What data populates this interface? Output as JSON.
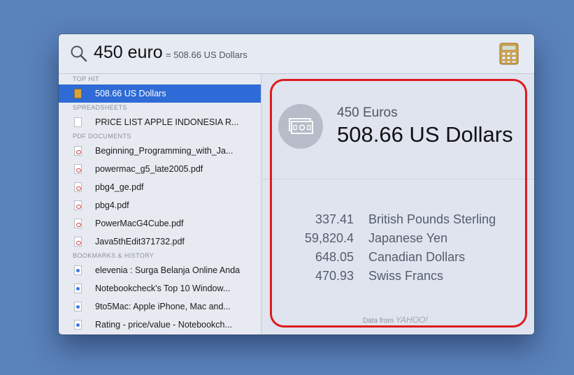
{
  "search": {
    "query": "450 euro",
    "inline_result": "= 508.66 US Dollars"
  },
  "icons": {
    "search": "magnifier-icon",
    "calculator": "calculator-icon",
    "currency": "banknote-icon"
  },
  "sections": {
    "top_hit": "TOP HIT",
    "spreadsheets": "SPREADSHEETS",
    "pdf_documents": "PDF DOCUMENTS",
    "bookmarks": "BOOKMARKS & HISTORY"
  },
  "items": {
    "top_hit": "508.66 US Dollars",
    "spreadsheets": [
      "PRICE LIST APPLE INDONESIA R..."
    ],
    "pdfs": [
      "Beginning_Programming_with_Ja...",
      "powermac_g5_late2005.pdf",
      "pbg4_ge.pdf",
      "pbg4.pdf",
      "PowerMacG4Cube.pdf",
      "Java5thEdit371732.pdf"
    ],
    "bookmarks": [
      "elevenia : Surga Belanja Online Anda",
      "Notebookcheck's Top 10 Window...",
      "9to5Mac: Apple iPhone, Mac and...",
      "Rating - price/value - Notebookch..."
    ]
  },
  "detail": {
    "source_amount": "450 Euros",
    "converted": "508.66 US Dollars",
    "rates": [
      {
        "value": "337.41",
        "currency": "British Pounds Sterling"
      },
      {
        "value": "59,820.4",
        "currency": "Japanese Yen"
      },
      {
        "value": "648.05",
        "currency": "Canadian Dollars"
      },
      {
        "value": "470.93",
        "currency": "Swiss Francs"
      }
    ],
    "credit_prefix": "Data from",
    "credit_brand": "YAHOO!"
  },
  "colors": {
    "desktop": "#5a82bb",
    "selection": "#2e6bd6",
    "annotation": "#dd1b1b"
  }
}
